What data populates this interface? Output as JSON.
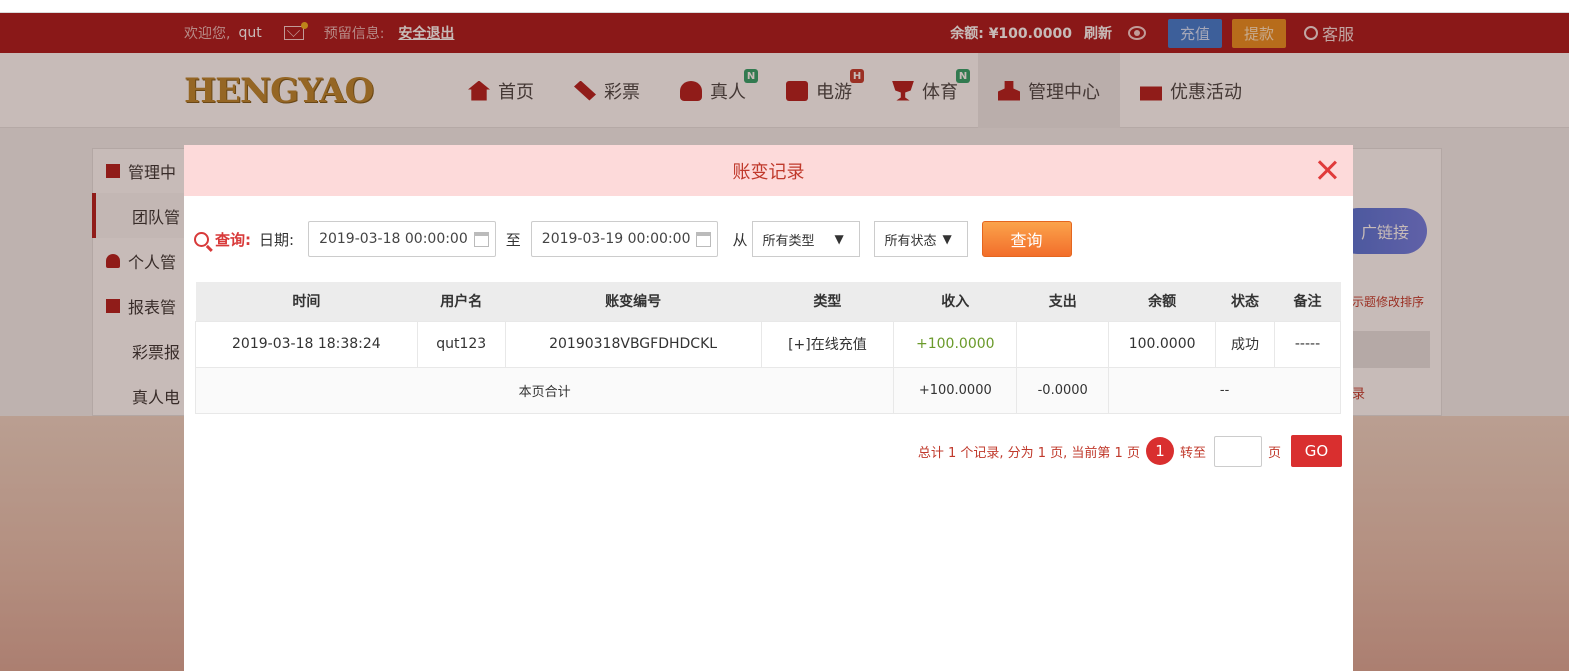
{
  "topbar": {
    "welcome": "欢迎您,",
    "username": "qut",
    "reserved_info": "预留信息:",
    "logout": "安全退出",
    "balance": "余额: ¥100.0000",
    "refresh": "刷新",
    "topup": "充值",
    "withdraw": "提款",
    "service": "客服"
  },
  "logo_text": "HENGYAO",
  "nav": [
    {
      "label": "首页",
      "icon": "home-icon"
    },
    {
      "label": "彩票",
      "icon": "ticket-icon"
    },
    {
      "label": "真人",
      "icon": "dealer-icon",
      "badge": "N"
    },
    {
      "label": "电游",
      "icon": "game-icon",
      "badge": "H"
    },
    {
      "label": "体育",
      "icon": "trophy-icon",
      "badge": "N"
    },
    {
      "label": "管理中心",
      "icon": "team-icon",
      "active": true
    },
    {
      "label": "优惠活动",
      "icon": "gift-icon"
    }
  ],
  "sidebar": [
    {
      "label": "管理中"
    },
    {
      "label": "团队管"
    },
    {
      "label": "个人管"
    },
    {
      "label": "报表管"
    },
    {
      "label": "彩票报"
    },
    {
      "label": "真人电"
    }
  ],
  "background": {
    "promo_button": "广链接",
    "note": "示题修改排序",
    "link": "录"
  },
  "modal": {
    "title": "账变记录",
    "query_label": "查询:",
    "date_label": "日期:",
    "date_from": "2019-03-18 00:00:00",
    "to_label": "至",
    "date_to": "2019-03-19 00:00:00",
    "from_label": "从",
    "type_select": "所有类型",
    "status_select": "所有状态",
    "query_button": "查询",
    "columns": [
      "时间",
      "用户名",
      "账变编号",
      "类型",
      "收入",
      "支出",
      "余额",
      "状态",
      "备注"
    ],
    "rows": [
      {
        "time": "2019-03-18 18:38:24",
        "user": "qut123",
        "id": "20190318VBGFDHDCKL",
        "type": "[+]在线充值",
        "income": "+100.0000",
        "expense": "",
        "balance": "100.0000",
        "status": "成功",
        "note": "-----"
      }
    ],
    "total": {
      "label": "本页合计",
      "income": "+100.0000",
      "expense": "-0.0000",
      "rest": "--"
    },
    "pager": {
      "summary": "总计 1 个记录, 分为 1 页, 当前第 1 页",
      "current_page": "1",
      "goto_label": "转至",
      "page_unit": "页",
      "go": "GO"
    }
  },
  "colors": {
    "brand_red": "#a8161a",
    "accent_red": "#d92f2f",
    "query_orange": "#f26e2b",
    "income_green": "#6a9a2a"
  }
}
